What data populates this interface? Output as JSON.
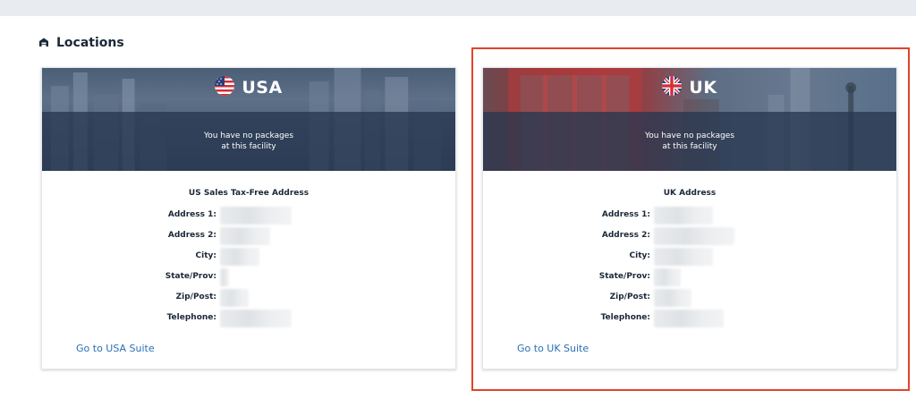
{
  "section": {
    "title": "Locations",
    "icon": "warehouse-icon"
  },
  "cards": {
    "usa": {
      "country": "USA",
      "flag": "us-flag-icon",
      "message_line1": "You have no packages",
      "message_line2": "at this facility",
      "address_title": "US Sales Tax-Free Address",
      "labels": [
        "Address 1:",
        "Address 2:",
        "City:",
        "State/Prov:",
        "Zip/Post:",
        "Telephone:"
      ],
      "link": "Go to USA Suite"
    },
    "uk": {
      "country": "UK",
      "flag": "uk-flag-icon",
      "message_line1": "You have no packages",
      "message_line2": "at this facility",
      "address_title": "UK Address",
      "labels": [
        "Address 1:",
        "Address 2:",
        "City:",
        "State/Prov:",
        "Zip/Post:",
        "Telephone:"
      ],
      "link": "Go to UK Suite"
    }
  },
  "colors": {
    "highlight": "#e2432a",
    "link": "#2a6fb4",
    "heading": "#1b2838"
  }
}
